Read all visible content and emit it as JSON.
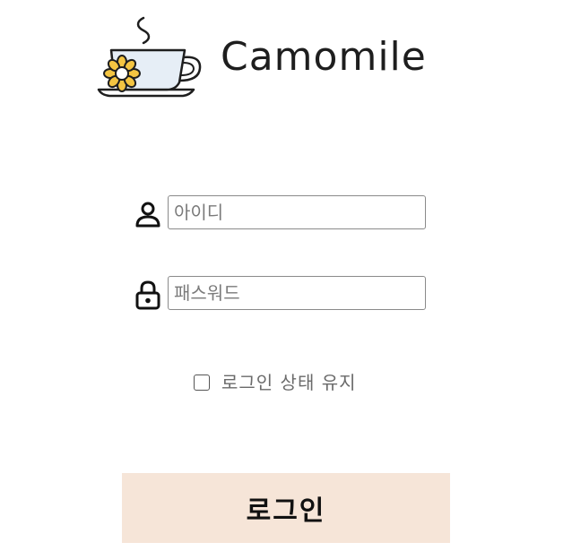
{
  "brand": {
    "name": "Camomile",
    "icon": "teacup-with-camomile-flower-icon"
  },
  "login_form": {
    "id_field": {
      "icon": "user-icon",
      "placeholder": "아이디",
      "value": ""
    },
    "password_field": {
      "icon": "lock-icon",
      "placeholder": "패스워드",
      "value": ""
    },
    "remember_me": {
      "label": "로그인 상태 유지",
      "checked": false
    },
    "submit_label": "로그인"
  },
  "colors": {
    "button_background": "#f6e5d8",
    "flower_petal": "#f4c542",
    "text_dark": "#1e1e1e",
    "text_muted": "#6a6a6a"
  }
}
